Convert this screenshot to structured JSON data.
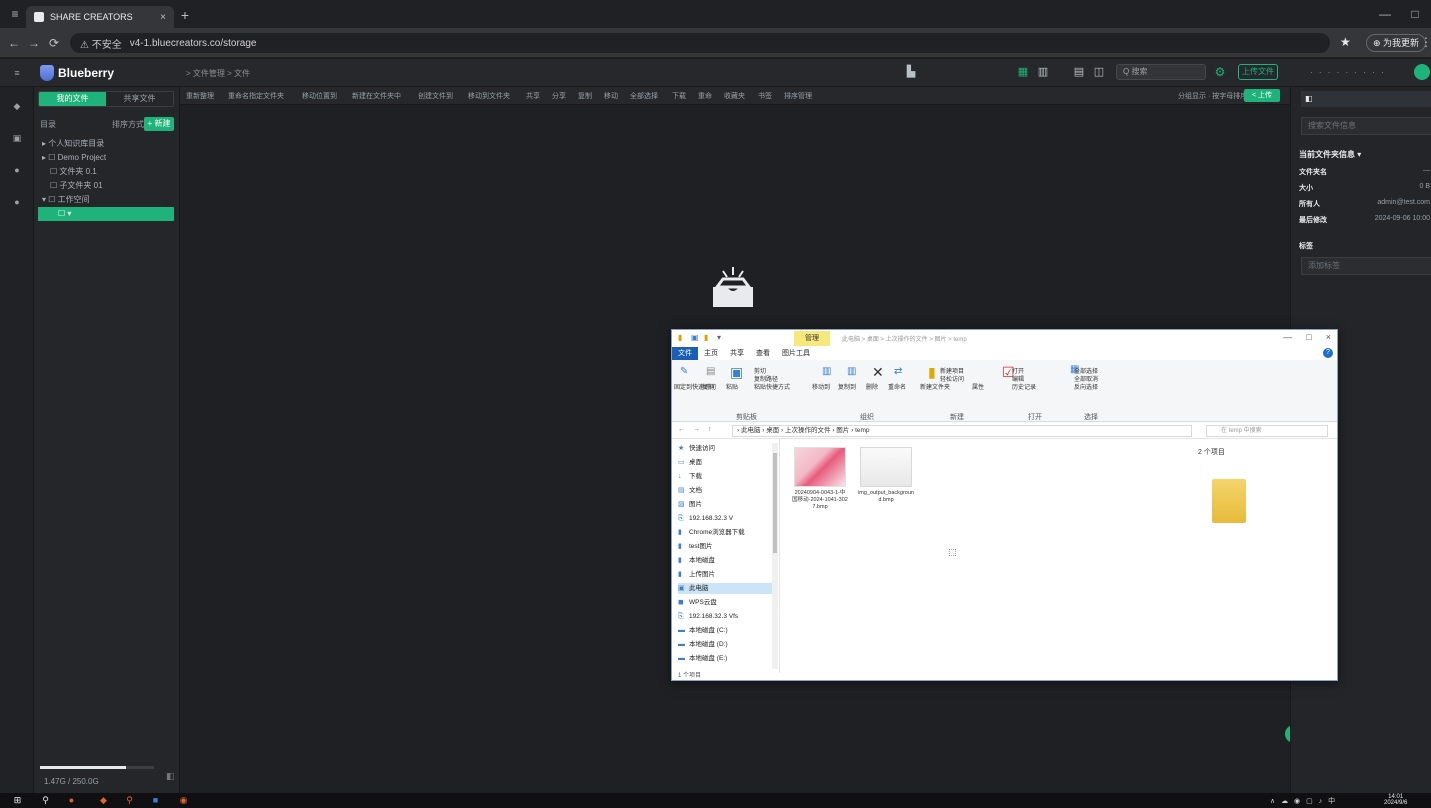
{
  "browser": {
    "tab_title": "SHARE CREATORS",
    "tab_close": "×",
    "new_tab": "+",
    "window_controls": [
      "—",
      "□"
    ],
    "nav": {
      "back": "←",
      "forward": "→",
      "reload": "⟳"
    },
    "security_warning": "⚠ 不安全",
    "url": "v4-1.bluecreators.co/storage",
    "bookmark_icon": "star-icon",
    "profile_button": "⊕ 为我更新",
    "menu": "⋮"
  },
  "app": {
    "name": "Blueberry",
    "breadcrumb": "> 文件管理 > 文件",
    "header_icons": [
      "trash-icon",
      "grid-view-icon",
      "list-view-icon",
      "filter-icon",
      "refresh-icon"
    ],
    "search_placeholder": "Q 搜索",
    "header_pill": "上传文件",
    "header_right": "· · · · · · · · ·",
    "accent_color": "#1db37a"
  },
  "sidebar": {
    "tabs": [
      {
        "label": "我的文件",
        "active": true
      },
      {
        "label": "共享文件",
        "active": false
      }
    ],
    "toolbar_label": "目录",
    "sort_label": "排序方式 ▾",
    "new_button": "+ 新建",
    "tree": [
      {
        "label": "▸ 个人知识库目录",
        "indent": 0,
        "selected": false
      },
      {
        "label": "▸ ☐ Demo Project",
        "indent": 0,
        "selected": false
      },
      {
        "label": "☐ 文件夹 0.1",
        "indent": 1,
        "selected": false
      },
      {
        "label": "☐ 子文件夹 01",
        "indent": 1,
        "selected": false
      },
      {
        "label": "▾ ☐ 工作空间",
        "indent": 0,
        "selected": false
      },
      {
        "label": "☐ ▾",
        "indent": 2,
        "selected": true
      }
    ],
    "storage_used_fraction": 0.75,
    "footer_text": "1.47G / 250.0G"
  },
  "toolbar": {
    "items": [
      "重新整理",
      "重命名指定文件夹",
      "移动位置到",
      "新建在文件夹中",
      "创建文件到",
      "移动到文件夹",
      "共享",
      "分享",
      "复制",
      "移动",
      "全部选择",
      "下载",
      "重命",
      "收藏夹",
      "书签",
      "排序管理"
    ],
    "right_text": "分组显示 · 按字母排序 ▾",
    "right_button": "< 上传"
  },
  "right_panel": {
    "tab_label": "◧",
    "search_placeholder": "搜索文件信息",
    "heading": "当前文件夹信息 ▾",
    "rows": [
      {
        "key": "文件夹名",
        "value": "—"
      },
      {
        "key": "大小",
        "value": "0 B"
      },
      {
        "key": "所有人",
        "value": "admin@test.com"
      },
      {
        "key": "最后修改",
        "value": "2024-09-06 10:00"
      }
    ],
    "tags_label": "标签",
    "tags_placeholder": "添加标签"
  },
  "explorer": {
    "context_tab": "管理",
    "title_path": "此电脑 > 桌面 > 上次操作的文件 > 图片 > temp",
    "window_controls": [
      "—",
      "□",
      "×"
    ],
    "ribbon_tabs": [
      "文件",
      "主页",
      "共享",
      "查看",
      "图片工具"
    ],
    "ribbon_groups": [
      "剪贴板",
      "组织",
      "新建",
      "打开",
      "选择"
    ],
    "ribbon_buttons": [
      "固定到快速访问",
      "复制",
      "粘贴",
      "剪切",
      "复制路径",
      "粘贴快捷方式",
      "移动到",
      "复制到",
      "删除",
      "重命名",
      "新建文件夹",
      "新建项目",
      "轻松访问",
      "属性",
      "打开",
      "编辑",
      "历史记录",
      "全部选择",
      "全部取消",
      "反向选择"
    ],
    "address_nav": "← → ↑",
    "address_path": "› 此电脑 › 桌面 › 上次操作的文件 › 图片 › temp",
    "search_placeholder": "在 temp 中搜索",
    "nav_items": [
      {
        "icon": "★",
        "label": "快速访问",
        "selected": false
      },
      {
        "icon": "▭",
        "label": "桌面",
        "selected": false
      },
      {
        "icon": "↓",
        "label": "下载",
        "selected": false
      },
      {
        "icon": "▤",
        "label": "文档",
        "selected": false
      },
      {
        "icon": "▨",
        "label": "图片",
        "selected": false
      },
      {
        "icon": "⎘",
        "label": "192.168.32.3 V",
        "selected": false
      },
      {
        "icon": "▮",
        "label": "Chrome浏览器下载",
        "selected": false
      },
      {
        "icon": "▮",
        "label": "test图片",
        "selected": false
      },
      {
        "icon": "▮",
        "label": "本地磁盘",
        "selected": false
      },
      {
        "icon": "▮",
        "label": "上传图片",
        "selected": false
      },
      {
        "icon": "▣",
        "label": "此电脑",
        "selected": true
      },
      {
        "icon": "◼",
        "label": "WPS云盘",
        "selected": false
      },
      {
        "icon": "⎘",
        "label": "192.168.32.3 Vfs",
        "selected": false
      },
      {
        "icon": "▬",
        "label": "本地磁盘 (C:)",
        "selected": false
      },
      {
        "icon": "▬",
        "label": "本地磁盘 (D:)",
        "selected": false
      },
      {
        "icon": "▬",
        "label": "本地磁盘 (E:)",
        "selected": false
      }
    ],
    "files": [
      {
        "name": "20240904-0043-1-中国移动-2024-1041-3027.bmp",
        "thumb": "pink"
      },
      {
        "name": "img_output_background.bmp",
        "thumb": "gray"
      }
    ],
    "item_count": "2 个项目",
    "status": "1 个项目"
  },
  "taskbar": {
    "icons": [
      "windows-icon",
      "search-icon",
      "browser-icon",
      "files-icon",
      "app-icon",
      "terminal-icon",
      "settings-icon"
    ],
    "tray": "∧ ☁ ◉ ▢ ♪ 中",
    "time": "14:01",
    "date": "2024/9/6"
  }
}
